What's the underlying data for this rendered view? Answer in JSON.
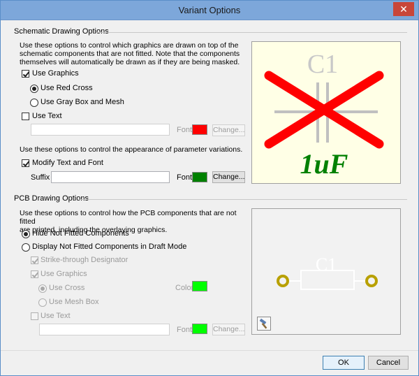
{
  "window": {
    "title": "Variant Options",
    "close_glyph": "✕"
  },
  "schematic": {
    "section_title": "Schematic Drawing Options",
    "description_line1": "Use these options to control which graphics are drawn on top of the",
    "description_line2": "schematic components that are not fitted. Note that the components",
    "description_line3": "themselves will automatically be drawn as if they are being masked.",
    "use_graphics": {
      "label": "Use Graphics",
      "checked": true
    },
    "use_red_cross": {
      "label": "Use Red Cross",
      "checked": true
    },
    "use_gray_box": {
      "label": "Use Gray Box and Mesh",
      "checked": false
    },
    "use_text": {
      "label": "Use Text",
      "checked": false
    },
    "use_text_value": "",
    "font_label": "Font",
    "font_color": "#ff0000",
    "change_label": "Change...",
    "variations_description": "Use these options to control the appearance of parameter variations.",
    "modify_text": {
      "label": "Modify Text and Font",
      "checked": true
    },
    "suffix_label": "Suffix",
    "suffix_value": "",
    "font2_label": "Font",
    "font2_color": "#008000",
    "change2_label": "Change...",
    "preview": {
      "designator": "C1",
      "value": "1uF",
      "background": "#ffffe6",
      "cross_color": "#ff0000",
      "value_color": "#008000"
    }
  },
  "pcb": {
    "section_title": "PCB Drawing Options",
    "description_line1": "Use these options to control how the PCB components that are not fitted",
    "description_line2": "are printed, including the overlaying graphics.",
    "hide_not_fitted": {
      "label": "Hide Not Fitted Components",
      "checked": true
    },
    "display_draft": {
      "label": "Display Not Fitted Components in Draft Mode",
      "checked": false
    },
    "strike_through": {
      "label": "Strike-through Designator",
      "checked": true
    },
    "use_graphics": {
      "label": "Use Graphics",
      "checked": true
    },
    "use_cross": {
      "label": "Use Cross",
      "checked": true
    },
    "use_mesh_box": {
      "label": "Use Mesh Box",
      "checked": false
    },
    "color_label": "Color",
    "color_value": "#00ff00",
    "use_text": {
      "label": "Use Text",
      "checked": false
    },
    "use_text_value": "",
    "font_label": "Font",
    "font_color": "#00ff00",
    "change_label": "Change...",
    "preview": {
      "designator": "C1",
      "background": "#f2f2f2",
      "pad_color": "#b8a000",
      "tool_icon": "hammer-icon"
    }
  },
  "buttons": {
    "ok": "OK",
    "cancel": "Cancel"
  }
}
